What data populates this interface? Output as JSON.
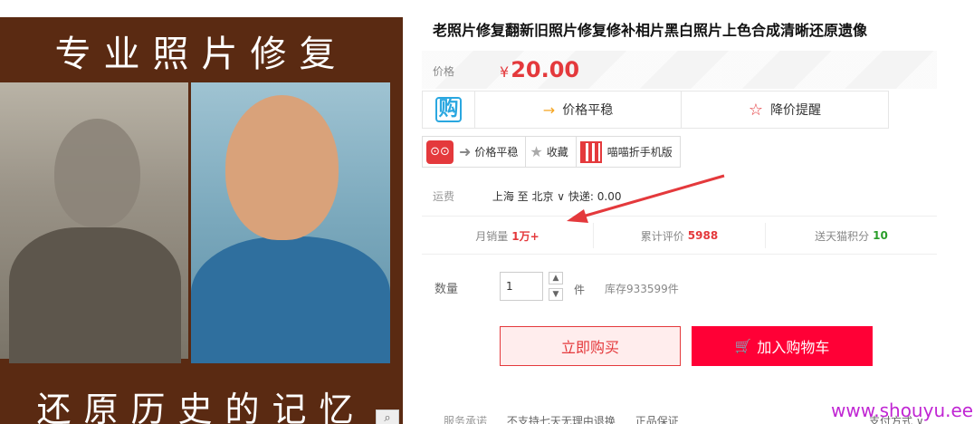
{
  "image": {
    "top_text": "专业照片修复",
    "bottom_text": "还原历史的记忆",
    "zoom_icon": "magnifier-icon"
  },
  "product": {
    "title": "老照片修复翻新旧照片修复修补相片黑白照片上色合成清晰还原遗像"
  },
  "price": {
    "label": "价格",
    "currency": "¥",
    "value": "20.00"
  },
  "promo": {
    "badge": "购",
    "trend": "价格平稳",
    "alert": "降价提醒"
  },
  "tools": {
    "trend": "价格平稳",
    "favorite": "收藏",
    "mobile": "喵喵折手机版"
  },
  "shipping": {
    "label": "运费",
    "text": "上海 至 北京 ∨ 快递: 0.00"
  },
  "stats": {
    "monthly_label": "月销量",
    "monthly_value": "1万+",
    "reviews_label": "累计评价",
    "reviews_value": "5988",
    "points_label": "送天猫积分",
    "points_value": "10"
  },
  "quantity": {
    "label": "数量",
    "value": "1",
    "unit": "件",
    "stock": "库存933599件"
  },
  "actions": {
    "buy_now": "立即购买",
    "add_cart": "加入购物车"
  },
  "services": {
    "label": "服务承诺",
    "item1": "不支持七天无理由退换",
    "item2": "正品保证",
    "pay": "支付方式 ∨"
  },
  "watermark": "www.shouyu.ee",
  "colors": {
    "accent": "#e4393c",
    "cart": "#ff0036",
    "annotation": "#e4393c"
  }
}
